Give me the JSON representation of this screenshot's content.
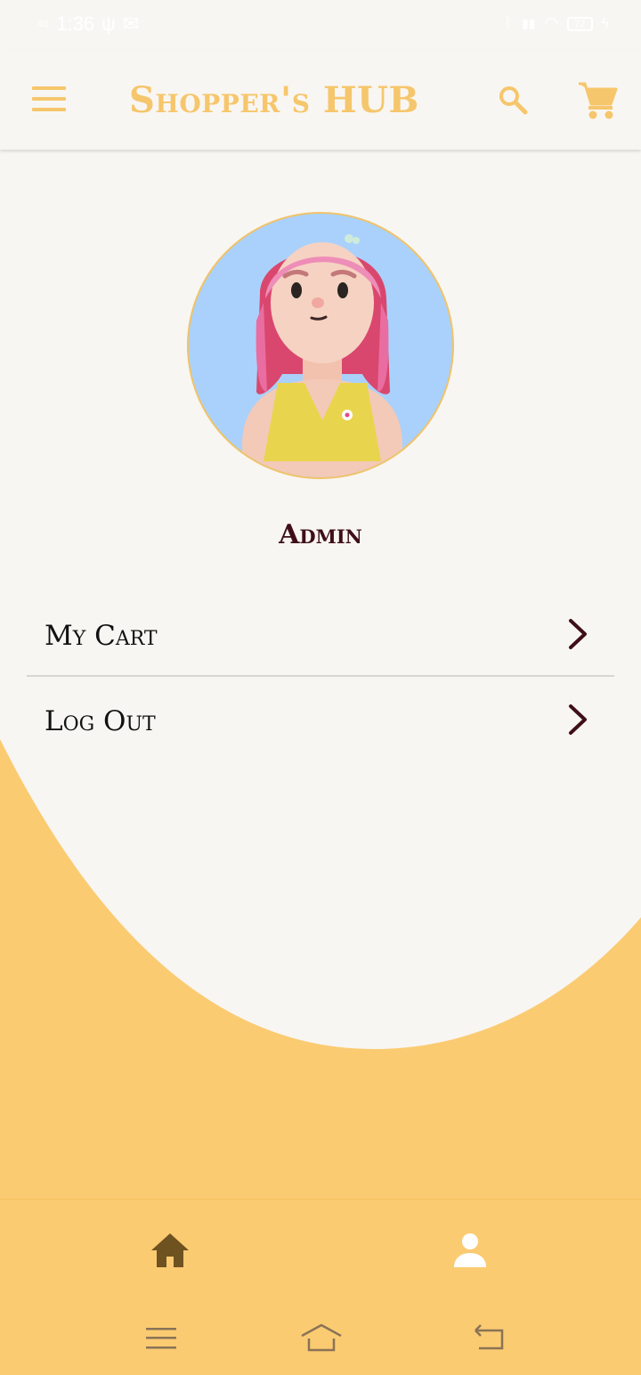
{
  "status_bar": {
    "network": "4G",
    "time": "1:36",
    "battery": "72"
  },
  "app_bar": {
    "title": "Shopper's HUB",
    "menu_icon": "hamburger-icon",
    "search_icon": "search-icon",
    "cart_icon": "cart-icon"
  },
  "profile": {
    "avatar_icon": "avatar-illustration",
    "username": "Admin"
  },
  "menu": {
    "items": [
      {
        "label": "My Cart",
        "icon": "chevron-right-icon"
      },
      {
        "label": "Log Out",
        "icon": "chevron-right-icon"
      }
    ]
  },
  "bottom_nav": {
    "items": [
      {
        "icon": "home-icon",
        "active": false
      },
      {
        "icon": "profile-icon",
        "active": true
      }
    ]
  },
  "colors": {
    "accent": "#F6C66C",
    "wave": "#FBCB72",
    "background": "#F8F6F2",
    "text_dark": "#3F0F18",
    "nav_inactive": "#6E5220"
  }
}
